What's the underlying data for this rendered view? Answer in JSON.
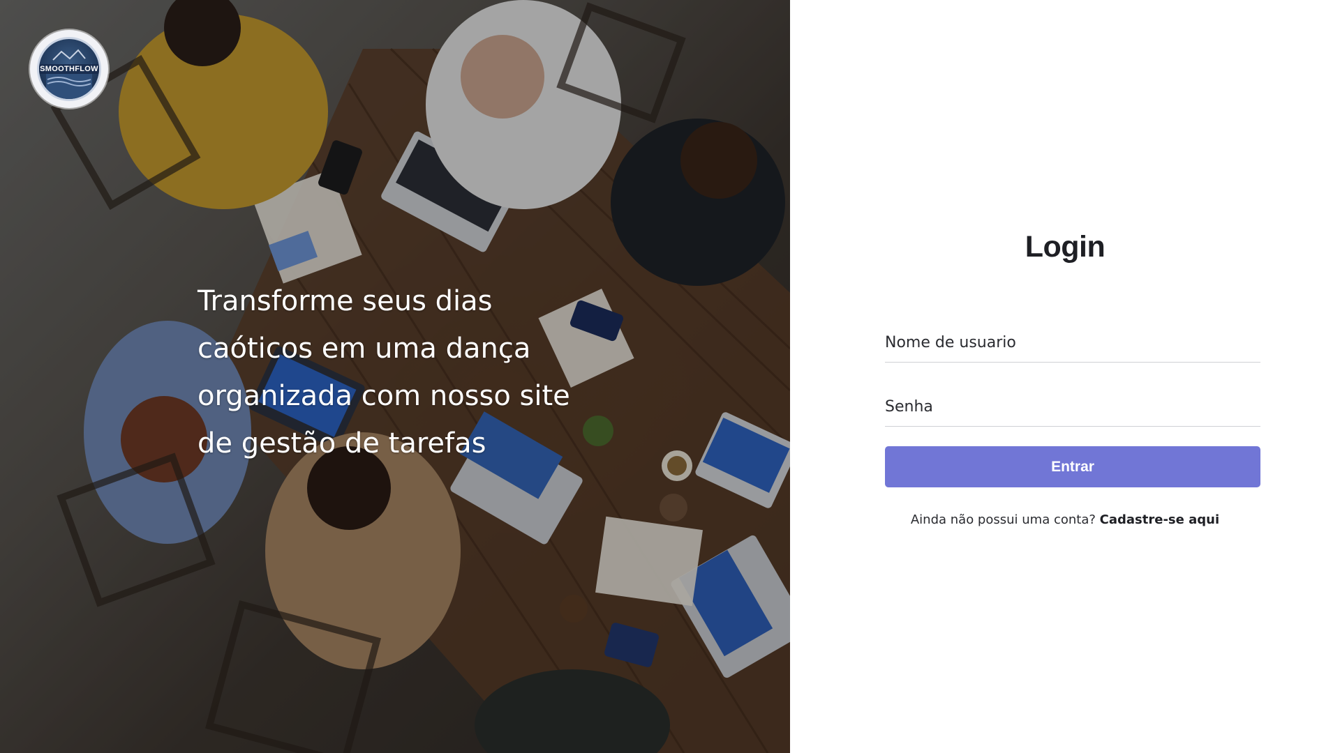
{
  "brand": {
    "logo_text": "SMOOTHFLOW",
    "logo_icon": "wave-mountain-badge-icon"
  },
  "hero": {
    "tagline": "Transforme seus dias caóticos em uma dança organizada com nosso site de gestão de tarefas",
    "tagline_lines": [
      "Transforme seus dias",
      "caóticos em uma dança",
      "organizada com nosso site",
      "de gestão de tarefas"
    ]
  },
  "login": {
    "title": "Login",
    "username_placeholder": "Nome de usuario",
    "password_placeholder": "Senha",
    "submit_label": "Entrar",
    "signup_prompt": "Ainda não possui uma conta?",
    "signup_link": "Cadastre-se aqui"
  },
  "colors": {
    "accent": "#7176d6",
    "title": "#1e1f24",
    "text": "#2a2b30",
    "divider": "#cfd0d4"
  }
}
